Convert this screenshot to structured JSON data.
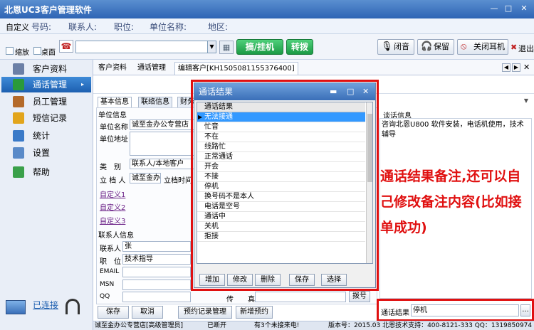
{
  "window": {
    "title": "北恩UC3客户管理软件",
    "controls": [
      "—",
      "□",
      "✕"
    ]
  },
  "infobar": {
    "custom": "自定义",
    "fields": [
      "号码:",
      "联系人:",
      "职位:",
      "单位名称:",
      "地区:"
    ]
  },
  "toolbar": {
    "shrink": "缩放",
    "desktop": "桌面",
    "pickup": "摘/挂机",
    "transfer": "转拨",
    "mute": "闭音",
    "hold": "保留",
    "close_headset": "关闭耳机",
    "exit": "退出"
  },
  "sidebar": {
    "items": [
      {
        "label": "客户资料",
        "color": "#6b7fa6"
      },
      {
        "label": "通话管理",
        "color": "#2a9a3a"
      },
      {
        "label": "员工管理",
        "color": "#b46a2a"
      },
      {
        "label": "短信记录",
        "color": "#e2a51c"
      },
      {
        "label": "统计",
        "color": "#3a7ac8"
      },
      {
        "label": "设置",
        "color": "#5a8ac8"
      },
      {
        "label": "帮助",
        "color": "#3aa04a"
      }
    ],
    "connected": "已连接"
  },
  "main_tabs": [
    "客户资料",
    "通话管理",
    "编辑客户[KH1505081155376400]"
  ],
  "sub_tabs": [
    "基本信息",
    "联络信息",
    "财务"
  ],
  "form": {
    "unit_info": "单位信息",
    "unit_name_label": "单位名称",
    "unit_name_value": "诚至金办公专营店",
    "unit_addr_label": "单位地址",
    "type_label": "类　别",
    "type_value": "联系人/本地客户",
    "creator_label": "立 档 人",
    "creator_value": "诚至金办公",
    "create_time_label": "立档时间",
    "custom1": "自定义1",
    "custom2": "自定义2",
    "custom3": "自定义3",
    "contact_info": "联系人信息",
    "contact_label": "联系人",
    "contact_value": "张",
    "position_label": "职　位",
    "position_value": "技术指导",
    "email_label": "EMAIL",
    "msn_label": "MSN",
    "qq_label": "QQ",
    "fax_label": "传　　真",
    "dial_btn": "拨号"
  },
  "bottom_buttons": [
    "保存",
    "取消",
    "预约记录管理",
    "新增预约"
  ],
  "talk_info": {
    "label": "谈话信息",
    "content": "咨询北恩U800 软件安装，电话机使用，技术辅导",
    "result_label": "通话结果",
    "result_value": "停机",
    "browse": "..."
  },
  "annotation": "通话结果备注,还可以自己修改备注内容(比如接单成功)",
  "dialog": {
    "title": "通话结果",
    "header": "通话结果",
    "items": [
      "无法接通",
      "忙音",
      "不在",
      "线路忙",
      "正常通话",
      "开会",
      "不接",
      "停机",
      "换号码不是本人",
      "电话是空号",
      "通话中",
      "关机",
      "拒接"
    ],
    "selected_index": 0,
    "buttons": [
      "增加",
      "修改",
      "删除",
      "保存",
      "选择"
    ]
  },
  "statusbar": {
    "user": "诚至金办公专营店[高级管理员]",
    "state": "已断开",
    "missed": "有3个未接来电!",
    "version": "版本号：2015.03 北恩技术支持：400-8121-333 QQ：1319850974"
  }
}
